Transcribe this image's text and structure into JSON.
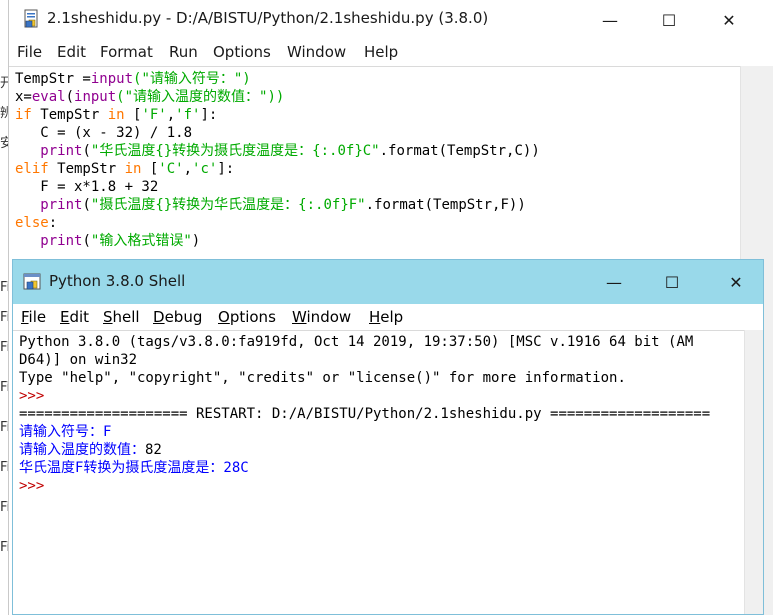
{
  "editor": {
    "title": "2.1sheshidu.py - D:/A/BISTU/Python/2.1sheshidu.py (3.8.0)",
    "controls": {
      "minimize": "—",
      "maximize": "☐",
      "close": "✕"
    },
    "menu": [
      "File",
      "Edit",
      "Format",
      "Run",
      "Options",
      "Window",
      "Help"
    ],
    "code_lines": [
      [
        {
          "t": "TempStr =",
          "c": ""
        },
        {
          "t": "input",
          "c": "bi"
        },
        {
          "t": "(\"请输入符号：\")",
          "c": "str"
        }
      ],
      [
        {
          "t": "x=",
          "c": ""
        },
        {
          "t": "eval",
          "c": "bi"
        },
        {
          "t": "(",
          "c": ""
        },
        {
          "t": "input",
          "c": "bi"
        },
        {
          "t": "(\"请输入温度的数值：\"))",
          "c": "str"
        }
      ],
      [
        {
          "t": "if",
          "c": "kw"
        },
        {
          "t": " TempStr ",
          "c": ""
        },
        {
          "t": "in",
          "c": "kw"
        },
        {
          "t": " [",
          "c": ""
        },
        {
          "t": "'F'",
          "c": "str"
        },
        {
          "t": ",",
          "c": ""
        },
        {
          "t": "'f'",
          "c": "str"
        },
        {
          "t": "]:",
          "c": ""
        }
      ],
      [
        {
          "t": "   C = (x - 32) / 1.8",
          "c": ""
        }
      ],
      [
        {
          "t": "   ",
          "c": ""
        },
        {
          "t": "print",
          "c": "bi"
        },
        {
          "t": "(",
          "c": ""
        },
        {
          "t": "\"华氏温度{}转换为摄氏度温度是：{:.0f}C\"",
          "c": "str"
        },
        {
          "t": ".format(TempStr,C))",
          "c": ""
        }
      ],
      [
        {
          "t": "elif",
          "c": "kw"
        },
        {
          "t": " TempStr ",
          "c": ""
        },
        {
          "t": "in",
          "c": "kw"
        },
        {
          "t": " [",
          "c": ""
        },
        {
          "t": "'C'",
          "c": "str"
        },
        {
          "t": ",",
          "c": ""
        },
        {
          "t": "'c'",
          "c": "str"
        },
        {
          "t": "]:",
          "c": ""
        }
      ],
      [
        {
          "t": "   F = x*1.8 + 32",
          "c": ""
        }
      ],
      [
        {
          "t": "   ",
          "c": ""
        },
        {
          "t": "print",
          "c": "bi"
        },
        {
          "t": "(",
          "c": ""
        },
        {
          "t": "\"摄氏温度{}转换为华氏温度是：{:.0f}F\"",
          "c": "str"
        },
        {
          "t": ".format(TempStr,F))",
          "c": ""
        }
      ],
      [
        {
          "t": "else",
          "c": "kw"
        },
        {
          "t": ":",
          "c": ""
        }
      ],
      [
        {
          "t": "   ",
          "c": ""
        },
        {
          "t": "print",
          "c": "bi"
        },
        {
          "t": "(",
          "c": ""
        },
        {
          "t": "\"输入格式错误\"",
          "c": "str"
        },
        {
          "t": ")",
          "c": ""
        }
      ]
    ]
  },
  "shell": {
    "title": "Python 3.8.0 Shell",
    "controls": {
      "minimize": "—",
      "maximize": "☐",
      "close": "✕"
    },
    "menu": [
      {
        "label": "File",
        "u": "F",
        "rest": "ile"
      },
      {
        "label": "Edit",
        "u": "E",
        "rest": "dit"
      },
      {
        "label": "Shell",
        "u": "S",
        "pre": "",
        "rest": "hell"
      },
      {
        "label": "Debug",
        "u": "D",
        "rest": "ebug"
      },
      {
        "label": "Options",
        "u": "O",
        "rest": "ptions"
      },
      {
        "label": "Window",
        "u": "W",
        "rest": "indow"
      },
      {
        "label": "Help",
        "u": "H",
        "rest": "elp"
      }
    ],
    "lines": [
      {
        "t": "Python 3.8.0 (tags/v3.8.0:fa919fd, Oct 14 2019, 19:37:50) [MSC v.1916 64 bit (AM",
        "c": ""
      },
      {
        "t": "D64)] on win32",
        "c": ""
      },
      {
        "t": "Type \"help\", \"copyright\", \"credits\" or \"license()\" for more information.",
        "c": ""
      },
      {
        "t": ">>>",
        "c": "prompt"
      },
      {
        "t": "==================== RESTART: D:/A/BISTU/Python/2.1sheshidu.py ===================",
        "c": ""
      },
      {
        "t": "请输入符号：F",
        "c": "stdout"
      },
      {
        "t": "请输入温度的数值：82",
        "c": "mixed",
        "a": "请输入温度的数值：",
        "b": "82"
      },
      {
        "t": "华氏温度F转换为摄氏度温度是：28C",
        "c": "stdout"
      },
      {
        "t": ">>>",
        "c": "prompt"
      }
    ]
  },
  "background": {
    "left_fragments": [
      "开",
      "辨",
      "安",
      "Fi",
      "Fi",
      "Fi",
      "Fi",
      "Fi",
      "Fi",
      "Fi",
      "Fi"
    ]
  }
}
